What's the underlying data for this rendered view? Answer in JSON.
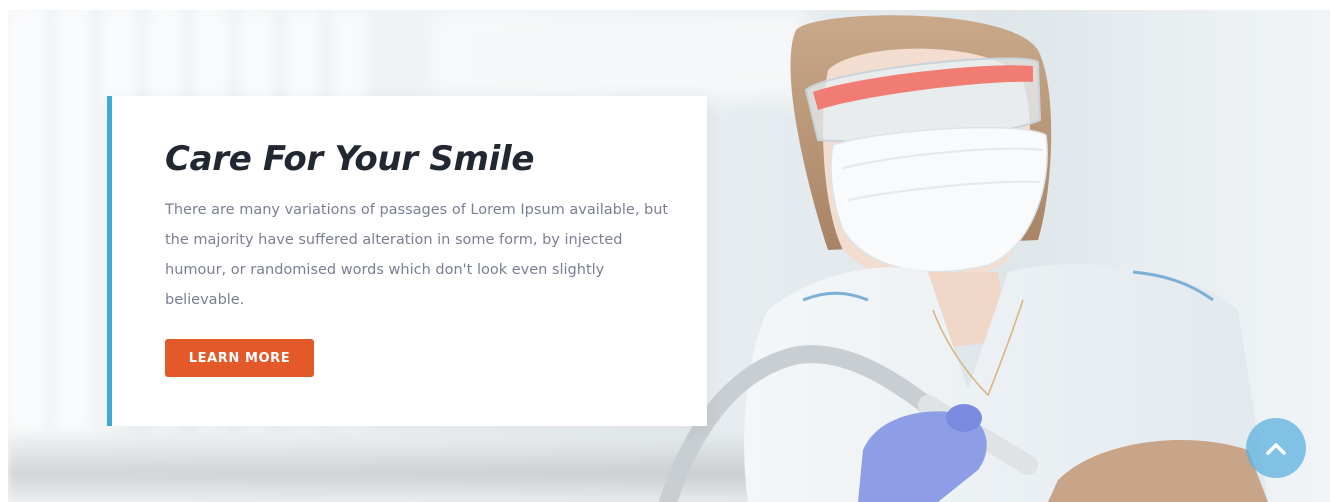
{
  "hero": {
    "title": "Care For Your Smile",
    "description": "There are many variations of passages of Lorem Ipsum available, but the majority have suffered alteration in some form, by injected humour, or randomised words which don't look even slightly believable.",
    "button_label": "LEARN MORE",
    "image": "dentist-with-mask-and-goggles"
  },
  "scroll_top": {
    "icon": "chevron-up-icon"
  },
  "colors": {
    "accent_border": "#3fa9d8",
    "button": "#e3592a",
    "title": "#222831",
    "body_text": "#7a7f93",
    "scroll_top": "#5cb0df"
  }
}
